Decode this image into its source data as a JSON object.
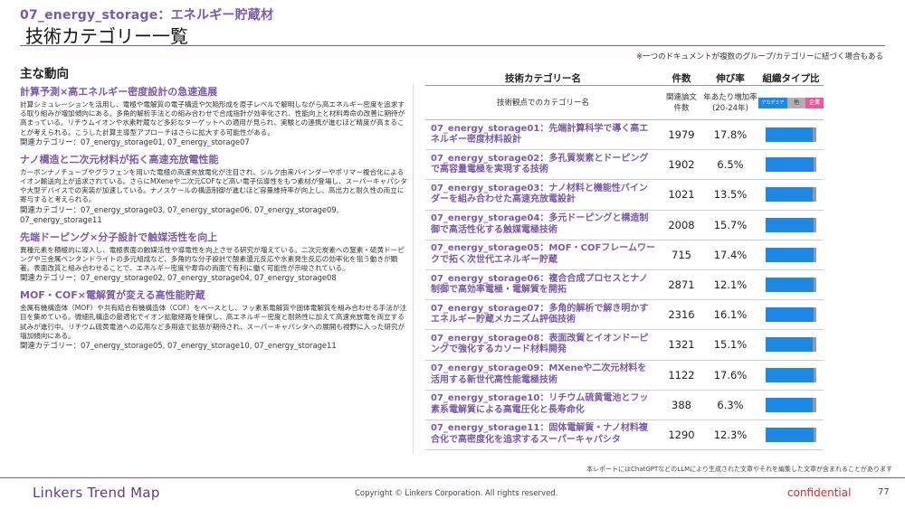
{
  "header": {
    "subtitle": "07_energy_storage：エネルギー貯蔵材",
    "title": "技術カテゴリー一覧",
    "note": "※一つのドキュメントが複数のグループ/カテゴリーに紐づく場合もある"
  },
  "left": {
    "heading": "主な動向",
    "sections": [
      {
        "title": "計算予測×高エネルギー密度設計の急速進展",
        "body": "計算シミュレーションを活用し、電極や電解質の電子構造や欠陥形成を原子レベルで解明しながら高エネルギー密度を追求する取り組みが増加傾向にある。多角的解析手法との組み合わせで合成指針が効率化され、性能向上と材料寿命の改善に期待が高まっている。リチウムイオンや水素貯蔵など多彩なターゲットへの適用が見られ、実験との連携が進むほど精度が高まることが考えられる。こうした計算主導型アプローチはさらに拡大する可能性がある。",
        "related": "関連カテゴリー：07_energy_storage01, 07_energy_storage07"
      },
      {
        "title": "ナノ構造と二次元材料が拓く高速充放電性能",
        "body": "カーボンナノチューブやグラフェンを用いた電極の高速充放電化が注目され、シルク由来バインダーやポリマー複合化によるイオン輸送向上が追求されている。さらにMXeneや二次元COFなど高い電子伝導性をもつ素材が登場し、スーパーキャパシタや大型デバイスでの実装が加速している。ナノスケールの構造制御が進むほど容量維持率が向上し、高出力と耐久性の両立に寄与すると考えられる。",
        "related": "関連カテゴリー：07_energy_storage03, 07_energy_storage06, 07_energy_storage09, 07_energy_storage11"
      },
      {
        "title": "先端ドーピング×分子設計で触媒活性を向上",
        "body": "異種元素を積極的に導入し、電極表面の触媒活性や導電性を向上させる研究が増えている。二次元炭素への窒素・硫黄ドーピングや三金属ペンタンドライトの多元組成など、多角的な分子設計で酸素還元反応や水素発生反応の効率化を狙う動きが顕著。表面改質と組み合わせることで、エネルギー密度や寿命の両面で有利に働く可能性が示唆されている。",
        "related": "関連カテゴリー：07_energy_storage02, 07_energy_storage04, 07_energy_storage08"
      },
      {
        "title": "MOF・COF×電解質が変える高性能貯蔵",
        "body": "金属有機構造体（MOF）や共有結合有機構造体（COF）をベースとし、フッ素系電解質や固体電解質を組み合わせる手法が注目を集めている。微細孔構造の最適化でイオン拡散経路を確保し、高エネルギー密度と耐熱性に加えて高速充放電を両立する試みが進行中。リチウム硫黄電池への応用など多用途で拡張が期待され、スーパーキャパシタへの展開も視野に入った研究が増加傾向にある。",
        "related": "関連カテゴリー：07_energy_storage05, 07_energy_storage10, 07_energy_storage11"
      }
    ]
  },
  "table": {
    "headers": {
      "category": "技術カテゴリー名",
      "docs": "件数",
      "growth": "伸び率",
      "type_ratio": "組織タイプ比"
    },
    "subheaders": {
      "category": "技術観点でのカテゴリー名",
      "docs_line1": "関連論文",
      "docs_line2": "件数",
      "growth_line1": "年あたり増加率",
      "growth_line2": "(20-24年)",
      "legend_a": "アカデミア",
      "legend_b": "他",
      "legend_c": "企業"
    },
    "rows": [
      {
        "name": "07_energy_storage01：先端計算科学で導く高エネルギー密度材料設計",
        "docs": "1979",
        "growth": "17.8%",
        "academia_ratio": 0.93
      },
      {
        "name": "07_energy_storage02：多孔質炭素とドーピングで高容量電極を実現する技術",
        "docs": "1902",
        "growth": "6.5%",
        "academia_ratio": 0.94
      },
      {
        "name": "07_energy_storage03：ナノ材料と機能性バインダーを組み合わせた高速充放電設計",
        "docs": "1021",
        "growth": "13.5%",
        "academia_ratio": 0.92
      },
      {
        "name": "07_energy_storage04：多元ドーピングと構造制御で高活性化する触媒電極技術",
        "docs": "2008",
        "growth": "15.7%",
        "academia_ratio": 0.94
      },
      {
        "name": "07_energy_storage05：MOF・COFフレームワークで拓く次世代エネルギー貯蔵",
        "docs": "715",
        "growth": "17.4%",
        "academia_ratio": 0.95
      },
      {
        "name": "07_energy_storage06：複合合成プロセスとナノ制御で高効率電極・電解質を開拓",
        "docs": "2871",
        "growth": "12.1%",
        "academia_ratio": 0.94
      },
      {
        "name": "07_energy_storage07：多角的解析で解き明かすエネルギー貯蔵メカニズム評価技術",
        "docs": "2316",
        "growth": "16.1%",
        "academia_ratio": 0.95
      },
      {
        "name": "07_energy_storage08：表面改質とイオンドーピングで強化するカソード材料開発",
        "docs": "1321",
        "growth": "15.1%",
        "academia_ratio": 0.92
      },
      {
        "name": "07_energy_storage09：MXeneや二次元材料を活用する新世代高性能電極技術",
        "docs": "1122",
        "growth": "17.6%",
        "academia_ratio": 0.94
      },
      {
        "name": "07_energy_storage10：リチウム硫黄電池とフッ素系電解質による高電圧化と長寿命化",
        "docs": "388",
        "growth": "6.3%",
        "academia_ratio": 0.93
      },
      {
        "name": "07_energy_storage11：固体電解質・ナノ材料複合化で高密度化を追求するスーパーキャパシタ",
        "docs": "1290",
        "growth": "12.3%",
        "academia_ratio": 0.94
      }
    ]
  },
  "footer": {
    "disclaimer": "本レポートにはChatGPTなどのLLMにより生成された文章やそれを編集した文章が含まれることがあります",
    "brand": "Linkers Trend Map",
    "copyright": "Copyright © Linkers Corporation. All rights reserved.",
    "confidential": "confidential",
    "page": "77"
  },
  "colors": {
    "accent": "#7b5aa6",
    "bar_academia": "#1e88e5",
    "bar_other": "#9a9a9a",
    "bar_company": "#e85a9b",
    "confidential": "#d62a2a"
  }
}
